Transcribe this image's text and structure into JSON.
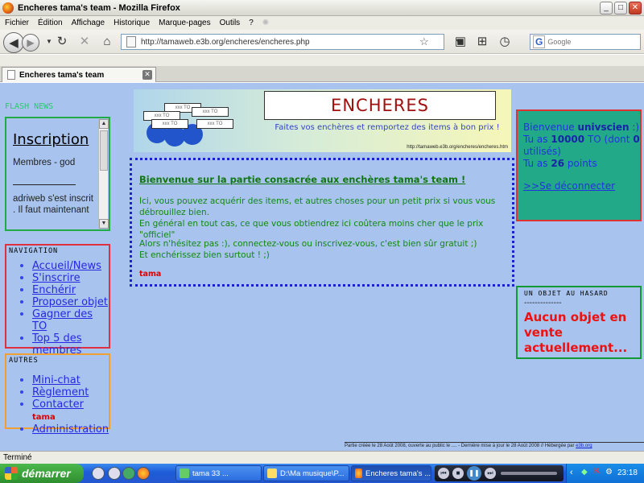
{
  "window": {
    "title": "Encheres tama's team - Mozilla Firefox"
  },
  "menu": [
    "Fichier",
    "Édition",
    "Affichage",
    "Historique",
    "Marque-pages",
    "Outils",
    "?"
  ],
  "urlbar": {
    "value": "http://tamaweb.e3b.org/encheres/encheres.php"
  },
  "search": {
    "placeholder": "Google"
  },
  "tab": {
    "label": "Encheres tama's team"
  },
  "sidebar": {
    "flash_title": "FLASH NEWS",
    "flash_heading": "Inscription",
    "flash_text1": "Membres - god",
    "flash_text2": "adriweb s'est inscrit . Il faut maintenant",
    "nav_title": "Navigation",
    "nav_items": [
      "Accueil/News",
      "S'inscrire",
      "Enchérir",
      "Proposer objet",
      "Gagner des TO",
      "Top 5 des membres"
    ],
    "autres_title": "Autres",
    "autres_items": [
      "Mini-chat",
      "Règlement",
      "Contacter",
      "Administration"
    ],
    "contact_tag": "tama"
  },
  "banner": {
    "title": "ENCHERES",
    "subtitle": "Faites vos enchères et remportez des items à bon prix !",
    "url": "http://tamaweb.e3b.org/encheres/encheres.htm",
    "card_labels": [
      "xxx TO",
      "xxx TO",
      "xxx TO",
      "xxx TO",
      "xxx TO"
    ]
  },
  "content": {
    "welcome": "Bienvenue sur la partie consacrée aux enchères tama's team !",
    "p1": "Ici, vous pouvez acquérir des items, et autres choses pour un petit prix si vous vous débrouillez bien.",
    "p2": "En général en tout cas, ce que vous obtiendrez ici coûtera moins cher que le prix \"officiel\"",
    "p3": "Alors n'hésitez pas :), connectez-vous ou inscrivez-vous, c'est bien sûr gratuit ;)",
    "p4": "Et enchérissez bien surtout ! ;)",
    "signature": "tama"
  },
  "user": {
    "welcome_prefix": "Bienvenue",
    "username": "univscien",
    "smiley": ":)",
    "to_prefix": "Tu as",
    "to_amount": "10000",
    "to_mid": "TO (dont",
    "to_used": "0",
    "to_suffix": "utilisés)",
    "points_prefix": "Tu as",
    "points": "26",
    "points_suffix": "points",
    "logout": ">>Se déconnecter"
  },
  "random_object": {
    "title": "Un objet au hasard",
    "divider": "--------------",
    "message": "Aucun objet en vente actuellement..."
  },
  "footer": {
    "text": "Partie créée le 28 Août 2008, ouverte au public le .... - Dernière mise à jour le 28 Août 2008 // Hébergée par",
    "host": "e3b.org"
  },
  "status": "Terminé",
  "taskbar": {
    "start": "démarrer",
    "tasks": [
      "tama          33 ...",
      "D:\\Ma musique\\P...",
      "Encheres tama's ..."
    ],
    "clock": "23:18"
  }
}
